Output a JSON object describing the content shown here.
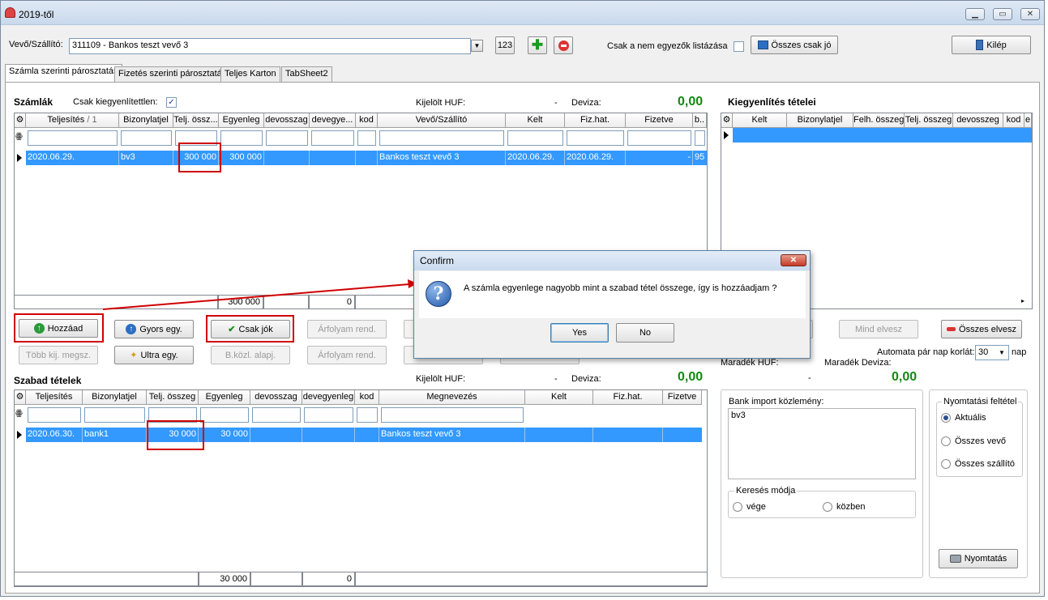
{
  "window": {
    "title": "2019-től"
  },
  "toolbar": {
    "vevo_label": "Vevő/Szállító:",
    "vevo_value": "311109 - Bankos teszt vevő 3",
    "num_button": "123",
    "filter_label": "Csak a nem egyezők listázása",
    "osszes_csak_jo": "Összes csak jó",
    "kilep": "Kilép"
  },
  "tabs": [
    "Számla szerinti párosztatás",
    "Fizetés szerinti párosztatás",
    "Teljes Karton",
    "TabSheet2"
  ],
  "szamlak": {
    "title": "Számlák",
    "only_unpaid_label": "Csak kiegyenlítettlen:",
    "kijelolt_label": "Kijelölt HUF:",
    "kijelolt_value": "-",
    "deviza_label": "Deviza:",
    "deviza_value": "0,00",
    "columns": [
      "Teljesítés",
      "Bizonylatjel",
      "Telj. össz...",
      "Egyenleg",
      "devosszag",
      "devegye...",
      "kod",
      "Vevő/Szállító",
      "Kelt",
      "Fiz.hat.",
      "Fizetve",
      "b.."
    ],
    "sort_indicator": "/ 1",
    "row": [
      "2020.06.29.",
      "bv3",
      "300 000",
      "300 000",
      "",
      "",
      "",
      "Bankos teszt vevő 3",
      "2020.06.29.",
      "2020.06.29.",
      "-",
      "95"
    ],
    "footer": [
      "300 000",
      "0"
    ]
  },
  "kiegyenlites": {
    "title": "Kiegyenlítés tételei",
    "columns": [
      "Kelt",
      "Bizonylatjel",
      "Felh. összeg",
      "Telj. összeg",
      "devosszeg",
      "kod",
      "e"
    ]
  },
  "buttons_row1": [
    "Hozzáad",
    "Gyors egy.",
    "Csak jók",
    "Árfolyam rend."
  ],
  "buttons_row2": [
    "Több kij. megsz.",
    "Ultra egy.",
    "B.közl. alapj.",
    "Árfolyam rend."
  ],
  "right_buttons": [
    "Mind elvesz",
    "Összes elvesz"
  ],
  "automata": {
    "label": "Automata pár nap korlát:",
    "value": "30",
    "unit": "nap"
  },
  "maradek": {
    "huf_label": "Maradék HUF:",
    "huf_value": "-",
    "deviza_label": "Maradék Deviza:",
    "deviza_value": "0,00"
  },
  "szabad": {
    "title": "Szabad tételek",
    "kijelolt_label": "Kijelölt HUF:",
    "kijelolt_value": "-",
    "deviza_label": "Deviza:",
    "deviza_value": "0,00",
    "columns": [
      "Teljesítés",
      "Bizonylatjel",
      "Telj. összeg",
      "Egyenleg",
      "devosszag",
      "devegyenleg",
      "kod",
      "Megnevezés",
      "Kelt",
      "Fiz.hat.",
      "Fizetve"
    ],
    "row": [
      "2020.06.30.",
      "bank1",
      "30 000",
      "30 000",
      "",
      "",
      "",
      "Bankos teszt vevő 3",
      "",
      "",
      ""
    ],
    "footer": [
      "30 000",
      "0"
    ]
  },
  "bank_import": {
    "label": "Bank import közlemény:",
    "value": "bv3"
  },
  "kereses": {
    "title": "Keresés módja",
    "options": [
      "vége",
      "közben"
    ]
  },
  "nyomtatasi": {
    "title": "Nyomtatási feltétel",
    "options": [
      "Aktuális",
      "Összes vevő",
      "Összes szállító"
    ],
    "print_button": "Nyomtatás"
  },
  "dialog": {
    "title": "Confirm",
    "message": "A számla egyenlege nagyobb mint a szabad tétel összege, így is hozzáadjam ?",
    "yes": "Yes",
    "no": "No"
  },
  "colors": {
    "selection": "#3399ff",
    "highlight": "#d00000",
    "value_green": "#118a11"
  }
}
